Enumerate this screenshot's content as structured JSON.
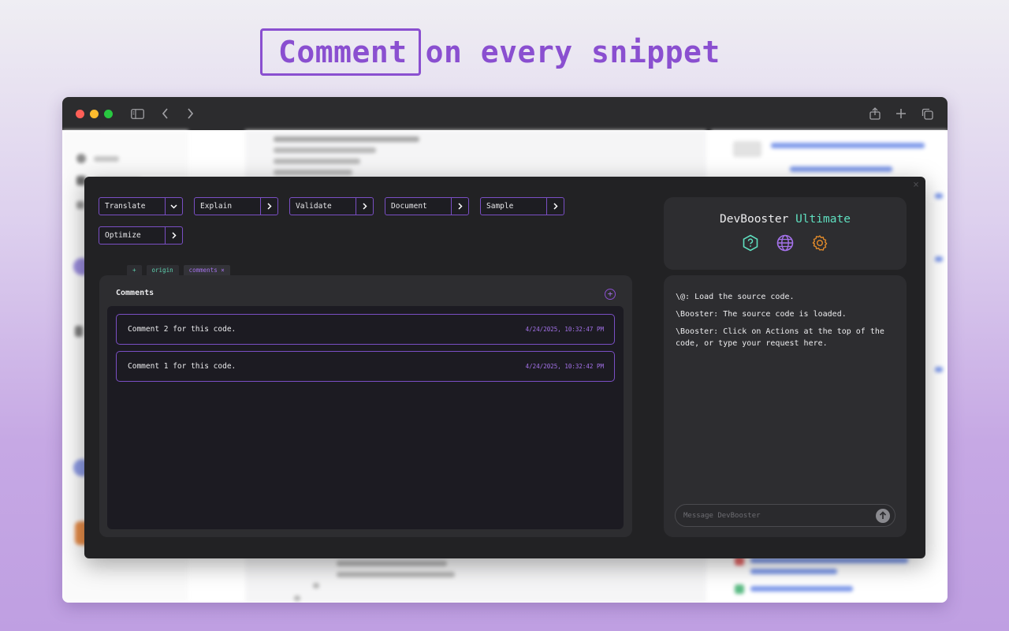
{
  "headline": {
    "highlight": "Comment",
    "rest": "on every snippet"
  },
  "colors": {
    "accent": "#8a4fd0",
    "teal": "#5fe0c0",
    "orange": "#e08a2a"
  },
  "browser": {
    "lights": [
      "#ff5f57",
      "#febc2e",
      "#28c840"
    ],
    "icons": [
      "sidebar-icon",
      "back-icon",
      "forward-icon",
      "share-icon",
      "new-tab-icon",
      "tabs-overview-icon"
    ]
  },
  "actions": [
    {
      "label": "Translate",
      "chevron": "down"
    },
    {
      "label": "Explain",
      "chevron": "right"
    },
    {
      "label": "Validate",
      "chevron": "right"
    },
    {
      "label": "Document",
      "chevron": "right"
    },
    {
      "label": "Sample",
      "chevron": "right"
    },
    {
      "label": "Optimize",
      "chevron": "right"
    }
  ],
  "tabs": {
    "plus": "+",
    "origin": "origin",
    "comments": "comments ×"
  },
  "comments": {
    "title": "Comments",
    "add": "+",
    "items": [
      {
        "text": "Comment 2 for this code.",
        "time": "4/24/2025, 10:32:47 PM"
      },
      {
        "text": "Comment 1 for this code.",
        "time": "4/24/2025, 10:32:42 PM"
      }
    ]
  },
  "brand": {
    "name": "DevBooster",
    "tier": "Ultimate",
    "icons": [
      "help-icon",
      "globe-icon",
      "settings-icon"
    ]
  },
  "chat": {
    "messages": [
      "\\@: Load the source code.",
      "\\Booster: The source code is loaded.",
      "\\Booster: Click on Actions at the top of the code, or type your request here."
    ],
    "placeholder": "Message DevBooster"
  },
  "overlay_close": "×"
}
